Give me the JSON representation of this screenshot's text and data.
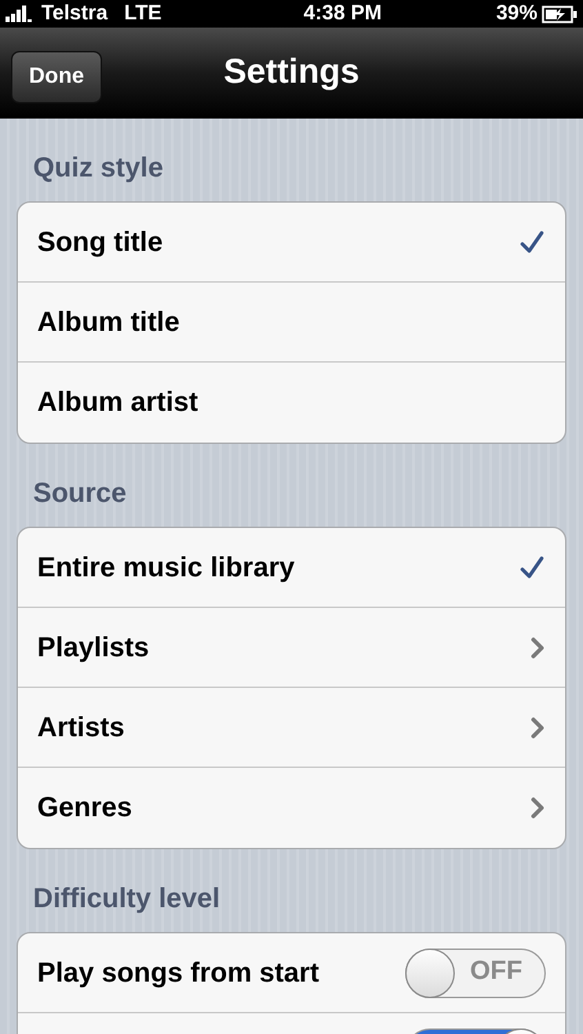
{
  "status_bar": {
    "carrier": "Telstra",
    "network": "LTE",
    "time": "4:38 PM",
    "battery": "39%"
  },
  "nav_bar": {
    "title": "Settings",
    "left_button": "Done"
  },
  "sections": [
    {
      "header": "Quiz style",
      "rows": [
        {
          "kind": "choice",
          "label": "Song title",
          "selected": true
        },
        {
          "kind": "choice",
          "label": "Album title",
          "selected": false
        },
        {
          "kind": "choice",
          "label": "Album artist",
          "selected": false
        }
      ]
    },
    {
      "header": "Source",
      "rows": [
        {
          "kind": "choice",
          "label": "Entire music library",
          "selected": true
        },
        {
          "kind": "link",
          "label": "Playlists"
        },
        {
          "kind": "link",
          "label": "Artists"
        },
        {
          "kind": "link",
          "label": "Genres"
        }
      ]
    },
    {
      "header": "Difficulty level",
      "rows": [
        {
          "kind": "switch",
          "label": "Play songs from start",
          "on": false,
          "switch_text": "OFF"
        },
        {
          "kind": "switch",
          "on": true
        }
      ]
    }
  ]
}
